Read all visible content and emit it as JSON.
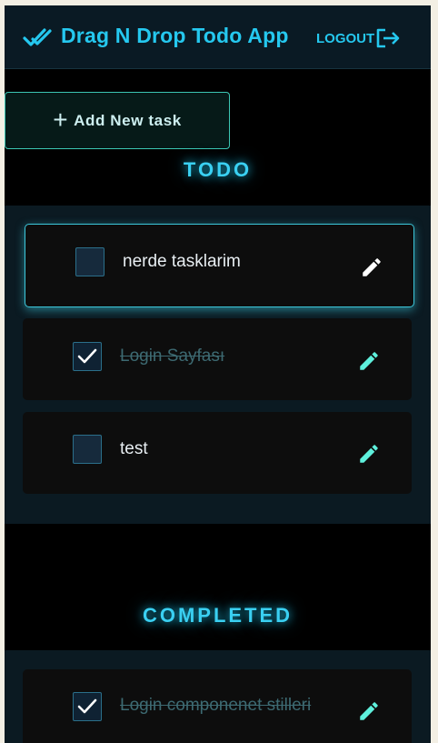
{
  "header": {
    "title": "Drag N Drop Todo App",
    "logout_label": "LOGOUT",
    "logo_icon": "double-check-icon",
    "logout_icon": "logout-arrow-icon"
  },
  "add_task": {
    "icon": "plus-icon",
    "label": "Add New task"
  },
  "sections": {
    "todo": {
      "title": "TODO",
      "tasks": [
        {
          "text": "nerde tasklarim",
          "checked": false
        },
        {
          "text": "Login Sayfası",
          "checked": true
        },
        {
          "text": "test",
          "checked": false
        }
      ]
    },
    "completed": {
      "title": "COMPLETED",
      "tasks": [
        {
          "text": "Login componenet stilleri",
          "checked": true
        }
      ]
    }
  },
  "colors": {
    "accent": "#25c8ef",
    "edit_icon": "#5ef0dc",
    "background": "#000000",
    "panel": "#0b1a22",
    "card": "#0d0d0d"
  }
}
